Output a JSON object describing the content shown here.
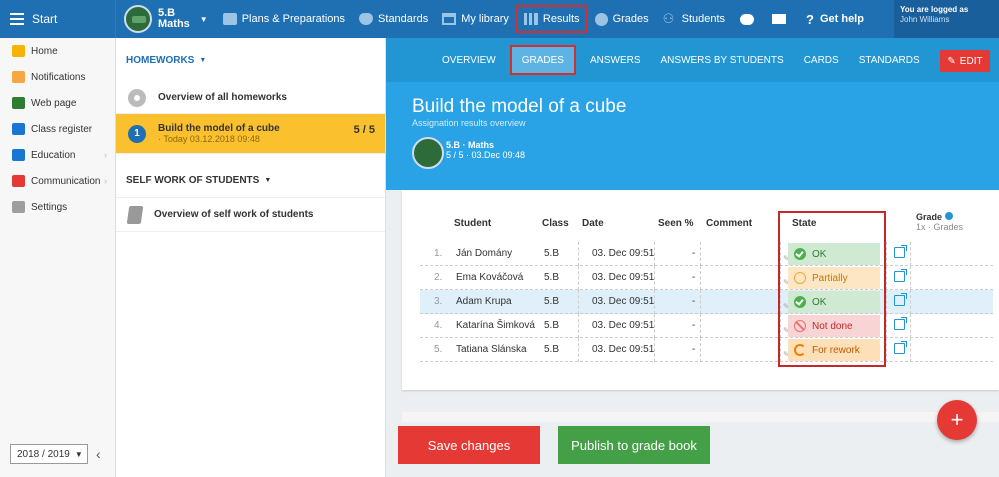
{
  "topbar": {
    "start_label": "Start",
    "class_line1": "5.B",
    "class_line2": "Maths",
    "items": [
      {
        "label": "Plans & Preparations",
        "icon": "briefcase-icon"
      },
      {
        "label": "Standards",
        "icon": "shield-icon"
      },
      {
        "label": "My library",
        "icon": "library-icon"
      },
      {
        "label": "Results",
        "icon": "bar-chart-icon"
      },
      {
        "label": "Grades",
        "icon": "grades-icon"
      },
      {
        "label": "Students",
        "icon": "students-icon"
      }
    ],
    "help_label": "Get help",
    "logged_as_label": "You are logged as",
    "user_name": "John Williams"
  },
  "sidebar": {
    "items": [
      {
        "label": "Home",
        "icon": "star-icon",
        "color": "#f4b400",
        "chevron": false
      },
      {
        "label": "Notifications",
        "icon": "envelope-icon",
        "color": "#f4a742",
        "chevron": false
      },
      {
        "label": "Web page",
        "icon": "home-icon",
        "color": "#2e7d32",
        "chevron": false
      },
      {
        "label": "Class register",
        "icon": "register-icon",
        "color": "#1976d2",
        "chevron": false
      },
      {
        "label": "Education",
        "icon": "education-icon",
        "color": "#1976d2",
        "chevron": true
      },
      {
        "label": "Communication",
        "icon": "communication-icon",
        "color": "#e53935",
        "chevron": true
      },
      {
        "label": "Settings",
        "icon": "gear-icon",
        "color": "#9e9e9e",
        "chevron": false
      }
    ],
    "year": "2018 / 2019"
  },
  "homeworks": {
    "header": "HOMEWORKS",
    "overview_label": "Overview of all homeworks",
    "active": {
      "number": "1",
      "title": "Build the model of a cube",
      "subtitle": "· Today 03.12.2018 09:48",
      "score": "5 / 5"
    },
    "self_header": "SELF WORK OF STUDENTS",
    "self_overview_label": "Overview of self work of students"
  },
  "tabs": [
    "OVERVIEW",
    "GRADES",
    "ANSWERS",
    "ANSWERS BY STUDENTS",
    "CARDS",
    "STANDARDS"
  ],
  "active_tab": "GRADES",
  "edit_label": "EDIT",
  "assignment": {
    "title": "Build the model of a cube",
    "subtitle": "Assignation results overview",
    "class_name": "5.B · Maths",
    "class_meta": "5 / 5 · 03.Dec 09:48"
  },
  "table": {
    "headers": {
      "student": "Student",
      "class": "Class",
      "date": "Date",
      "seen": "Seen %",
      "comment": "Comment",
      "state": "State",
      "grade": "Grade",
      "grade_sub": "1x · Grades"
    },
    "rows": [
      {
        "idx": "1.",
        "student": "Ján Domány",
        "class": "5.B",
        "date": "03. Dec 09:51",
        "seen": "-",
        "state": "OK",
        "state_kind": "ok"
      },
      {
        "idx": "2.",
        "student": "Ema Kováčová",
        "class": "5.B",
        "date": "03. Dec 09:51",
        "seen": "-",
        "state": "Partially",
        "state_kind": "part"
      },
      {
        "idx": "3.",
        "student": "Adam Krupa",
        "class": "5.B",
        "date": "03. Dec 09:51",
        "seen": "-",
        "state": "OK",
        "state_kind": "ok"
      },
      {
        "idx": "4.",
        "student": "Katarína Šimková",
        "class": "5.B",
        "date": "03. Dec 09:51",
        "seen": "-",
        "state": "Not done",
        "state_kind": "not"
      },
      {
        "idx": "5.",
        "student": "Tatiana Slánska",
        "class": "5.B",
        "date": "03. Dec 09:51",
        "seen": "-",
        "state": "For rework",
        "state_kind": "rework"
      }
    ]
  },
  "buttons": {
    "save": "Save changes",
    "publish": "Publish to grade book",
    "fab": "+"
  }
}
